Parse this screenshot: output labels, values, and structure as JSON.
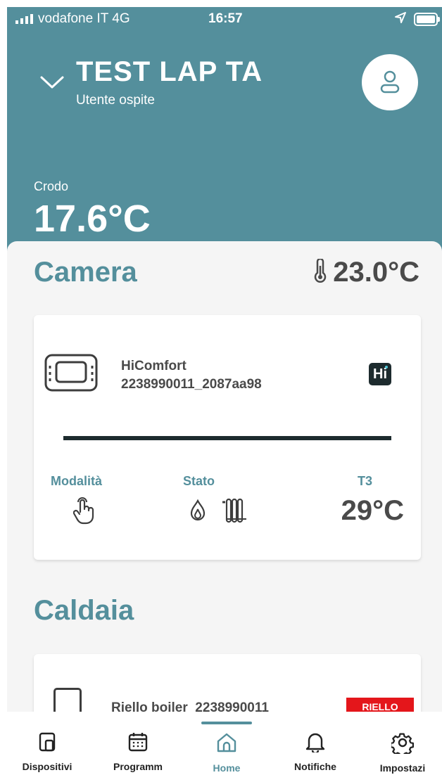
{
  "status_bar": {
    "carrier": "vodafone IT   4G",
    "time": "16:57"
  },
  "header": {
    "home_name": "TEST LAP TA",
    "user_role": "Utente ospite",
    "outdoor_label": "Crodo",
    "outdoor_temp": "17.6°C"
  },
  "room": {
    "name": "Camera",
    "temperature": "23.0°C",
    "device": {
      "name": "HiComfort",
      "id": "2238990011_2087aa98",
      "badge": "Hi",
      "mode_label": "Modalità",
      "state_label": "Stato",
      "t3_label": "T3",
      "t3_value": "29°C"
    }
  },
  "boiler": {
    "section_title": "Caldaia",
    "device_name": "Riello boiler_2238990011",
    "brand_logo": "RIELLO"
  },
  "tabbar": [
    {
      "label": "Dispositivi",
      "icon": "devices-icon"
    },
    {
      "label": "Programm",
      "icon": "calendar-icon"
    },
    {
      "label": "Home",
      "icon": "home-icon"
    },
    {
      "label": "Notifiche",
      "icon": "bell-icon"
    },
    {
      "label": "Impostazi",
      "icon": "gear-icon"
    }
  ],
  "colors": {
    "accent": "#548f9c",
    "dark": "#1d2b2e",
    "brand_red": "#e4161b"
  }
}
